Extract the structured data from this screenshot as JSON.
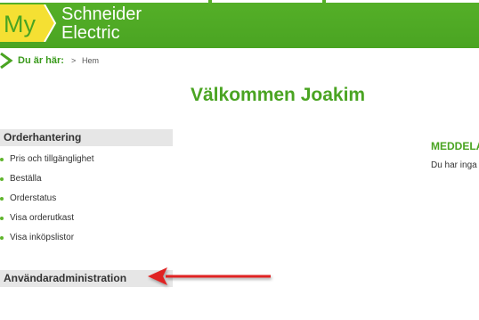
{
  "header": {
    "logo_my": "My",
    "logo_line1": "Schneider",
    "logo_line2": "Electric"
  },
  "breadcrumb": {
    "label": "Du är här:",
    "separator": ">",
    "home": "Hem"
  },
  "welcome": "Välkommen Joakim",
  "sidebar": {
    "sections": [
      {
        "title": "Orderhantering",
        "items": [
          "Pris och tillgänglighet",
          "Beställa",
          "Orderstatus",
          "Visa orderutkast",
          "Visa inköpslistor"
        ]
      },
      {
        "title": "Användaradministration"
      }
    ]
  },
  "news": {
    "title": "MEDDELA",
    "text": "Du har inga"
  },
  "colors": {
    "brand_green": "#4aa422",
    "logo_yellow": "#f5e033",
    "annotation_arrow": "#e02020"
  }
}
